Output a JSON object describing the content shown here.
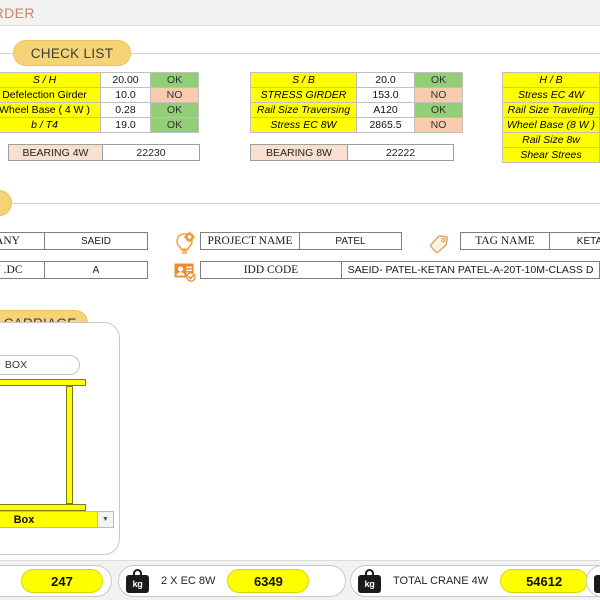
{
  "header": {
    "title": "GIRDER"
  },
  "sections": {
    "check_list": "CHECK LIST",
    "carriage": "D CARRIAGE"
  },
  "check_tables": [
    {
      "name": "girder-4w-checks",
      "rows": [
        {
          "label": "S / H",
          "value": "20.00",
          "status": "OK",
          "italic": true
        },
        {
          "label": "Defelection Girder",
          "value": "10.0",
          "status": "NO",
          "italic": false
        },
        {
          "label": "Wheel Base ( 4 W )",
          "value": "0.28",
          "status": "OK",
          "italic": false
        },
        {
          "label": "b / T4",
          "value": "19.0",
          "status": "OK",
          "italic": true
        }
      ]
    },
    {
      "name": "girder-8w-checks",
      "rows": [
        {
          "label": "S / B",
          "value": "20.0",
          "status": "OK",
          "italic": true
        },
        {
          "label": "STRESS GIRDER",
          "value": "153.0",
          "status": "NO",
          "italic": true
        },
        {
          "label": "Rail Size Traversing",
          "value": "A120",
          "status": "OK",
          "italic": true
        },
        {
          "label": "Stress EC   8W",
          "value": "2865.5",
          "status": "NO",
          "italic": true
        }
      ]
    },
    {
      "name": "additional-checks",
      "rows": [
        {
          "label": "H / B",
          "value": "",
          "status": "",
          "italic": true
        },
        {
          "label": "Stress EC   4W",
          "value": "",
          "status": "",
          "italic": true
        },
        {
          "label": "Rail Size Traveling",
          "value": "",
          "status": "",
          "italic": true
        },
        {
          "label": "Wheel Base (8 W )",
          "value": "",
          "status": "",
          "italic": true
        },
        {
          "label": "Rail Size 8w",
          "value": "",
          "status": "",
          "italic": true
        },
        {
          "label": "Shear Strees",
          "value": "",
          "status": "",
          "italic": true
        }
      ]
    }
  ],
  "bearings": [
    {
      "label": "BEARING 4W",
      "value": "22230"
    },
    {
      "label": "BEARING 8W",
      "value": "22222"
    }
  ],
  "project_info": {
    "company_label": "ANY",
    "company_value": "SAEID",
    "revision_label": "N .DC",
    "revision_value": "A",
    "project_label": "PROJECT NAME",
    "project_value": "PATEL",
    "tag_label": "TAG NAME",
    "tag_value": "KETA",
    "idd_label": "IDD CODE",
    "idd_value": "SAEID- PATEL-KETAN PATEL-A-20T-10M-CLASS D"
  },
  "icons": {
    "idea": "lightbulb-gear-icon",
    "idcard": "id-card-icon",
    "tag": "tag-icon",
    "weight": "kg-weight-icon",
    "dropdown": "chevron-down-icon"
  },
  "carriage": {
    "tab_label": "BOX",
    "combo_value": "Box"
  },
  "bottom_bar": {
    "items": [
      {
        "kind": "value",
        "value": "247"
      },
      {
        "kind": "weight",
        "label": "2 X EC 8W",
        "value": "6349"
      },
      {
        "kind": "weight",
        "label": "TOTAL CRANE 4W",
        "value": "54612"
      }
    ]
  },
  "colors": {
    "yellow": "#ffff00",
    "amber_pill": "#f5d376",
    "status_ok": "#92ce76",
    "status_no": "#f8cbad",
    "bearing_label": "#f8dfcf",
    "title_text": "#c9846a"
  }
}
